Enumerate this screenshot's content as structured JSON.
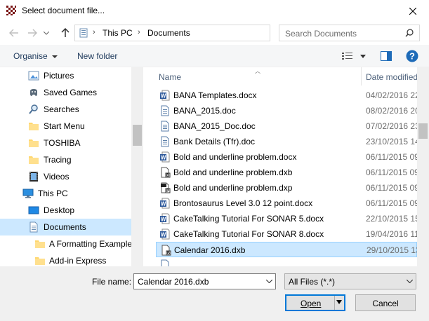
{
  "window": {
    "title": "Select document file..."
  },
  "address": {
    "crumbs": [
      "This PC",
      "Documents"
    ],
    "search_placeholder": "Search Documents"
  },
  "toolbar": {
    "organise": "Organise",
    "new_folder": "New folder"
  },
  "nav": {
    "items": [
      {
        "label": "Pictures",
        "icon": "pictures-icon"
      },
      {
        "label": "Saved Games",
        "icon": "saved-games-icon"
      },
      {
        "label": "Searches",
        "icon": "searches-icon"
      },
      {
        "label": "Start Menu",
        "icon": "folder-icon"
      },
      {
        "label": "TOSHIBA",
        "icon": "folder-icon"
      },
      {
        "label": "Tracing",
        "icon": "folder-icon"
      },
      {
        "label": "Videos",
        "icon": "videos-icon"
      },
      {
        "label": "This PC",
        "icon": "this-pc-icon"
      },
      {
        "label": "Desktop",
        "icon": "desktop-icon"
      },
      {
        "label": "Documents",
        "icon": "documents-icon",
        "selected": true
      },
      {
        "label": "A Formatting Example",
        "icon": "folder-icon"
      },
      {
        "label": "Add-in Express",
        "icon": "folder-icon"
      }
    ]
  },
  "files": {
    "headers": {
      "name": "Name",
      "date": "Date modified"
    },
    "rows": [
      {
        "name": "BANA Templates.docx",
        "date": "04/02/2016 22",
        "type": "word"
      },
      {
        "name": "BANA_2015.doc",
        "date": "08/02/2016 20",
        "type": "doc"
      },
      {
        "name": "BANA_2015_Doc.doc",
        "date": "07/02/2016 23",
        "type": "doc"
      },
      {
        "name": "Bank Details (Tfr).doc",
        "date": "23/10/2015 14",
        "type": "doc"
      },
      {
        "name": "Bold and underline problem.docx",
        "date": "06/11/2015 09",
        "type": "word"
      },
      {
        "name": "Bold and underline problem.dxb",
        "date": "06/11/2015 09",
        "type": "dxb"
      },
      {
        "name": "Bold and underline problem.dxp",
        "date": "06/11/2015 09",
        "type": "dxp"
      },
      {
        "name": "Brontosaurus Level 3.0 12 point.docx",
        "date": "06/11/2015 09",
        "type": "word"
      },
      {
        "name": "CakeTalking Tutorial For SONAR 5.docx",
        "date": "22/10/2015 15",
        "type": "word"
      },
      {
        "name": "CakeTalking Tutorial For SONAR 8.docx",
        "date": "19/04/2016 11",
        "type": "word"
      },
      {
        "name": "Calendar 2016.dxb",
        "date": "29/10/2015 13",
        "type": "dxb",
        "selected": true
      }
    ]
  },
  "bottom": {
    "filename_label": "File name:",
    "filename_value": "Calendar 2016.dxb",
    "filetype_value": "All Files (*.*)",
    "open_label": "Open",
    "cancel_label": "Cancel"
  }
}
